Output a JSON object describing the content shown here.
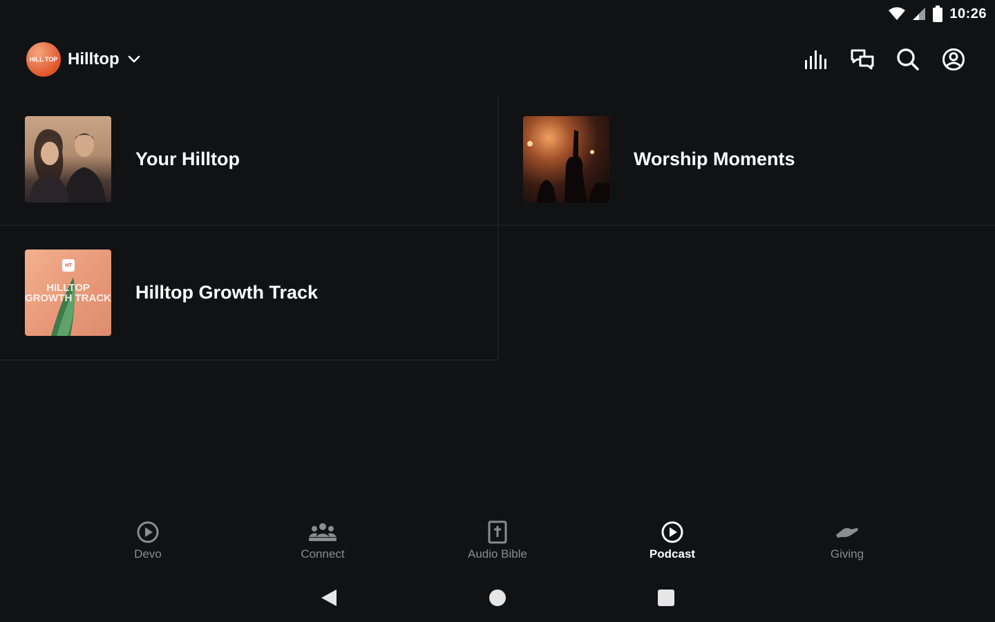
{
  "status_bar": {
    "time": "10:26",
    "icons": [
      "wifi-icon",
      "signal-icon",
      "battery-icon"
    ]
  },
  "header": {
    "logo_text": "HILL TOP",
    "brand_name": "Hilltop",
    "actions": [
      "equalizer-icon",
      "chat-icon",
      "search-icon",
      "account-icon"
    ]
  },
  "podcasts": [
    {
      "title": "Your Hilltop",
      "thumb": "your-hilltop-cover"
    },
    {
      "title": "Worship Moments",
      "thumb": "worship-moments-cover"
    },
    {
      "title": "Hilltop Growth Track",
      "thumb": "growth-track-cover",
      "cover_text": "HILLTOP GROWTH TRACK"
    }
  ],
  "bottom_nav": {
    "items": [
      {
        "label": "Devo",
        "icon": "play-circle-icon",
        "active": false
      },
      {
        "label": "Connect",
        "icon": "group-icon",
        "active": false
      },
      {
        "label": "Audio Bible",
        "icon": "bible-icon",
        "active": false
      },
      {
        "label": "Podcast",
        "icon": "play-circle-icon",
        "active": true
      },
      {
        "label": "Giving",
        "icon": "giving-hand-icon",
        "active": false
      }
    ]
  },
  "colors": {
    "background": "#111214",
    "divider": "#1d1e21",
    "inactive_text": "#8b8c8f",
    "active_text": "#ffffff",
    "brand_accent": "#e2552a"
  }
}
